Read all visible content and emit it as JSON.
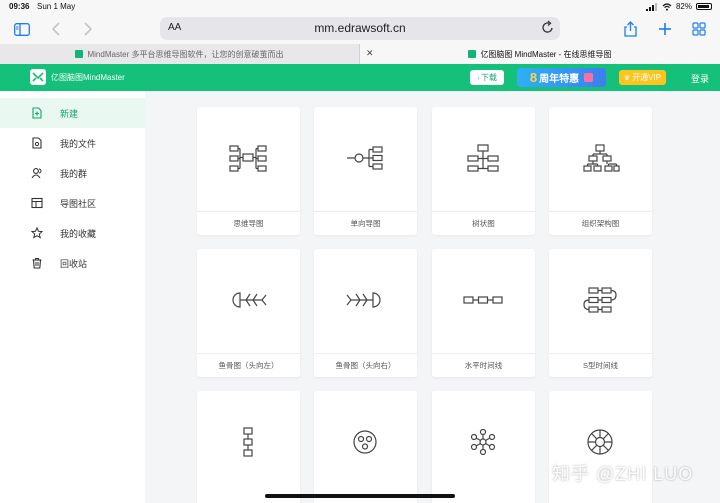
{
  "status": {
    "time": "09:36",
    "date": "Sun 1 May",
    "battery": "82%"
  },
  "browser": {
    "aa": "AA",
    "url": "mm.edrawsoft.cn",
    "tabs": [
      {
        "label": "MindMaster 多平台思维导图软件，让您的创意破茧而出",
        "active": false
      },
      {
        "label": "亿图脑图 MindMaster - 在线思维导图",
        "active": true
      }
    ]
  },
  "appbar": {
    "brand": "亿图脑图MindMaster",
    "download": "下载",
    "promo_number": "8",
    "promo_text": "周年特惠",
    "vip": "开通VIP",
    "login": "登录",
    "colors": {
      "header": "#14c07a",
      "vip": "#ffc41e"
    }
  },
  "sidebar": {
    "items": [
      {
        "label": "新建",
        "icon": "new-file-icon",
        "active": true
      },
      {
        "label": "我的文件",
        "icon": "my-files-icon",
        "active": false
      },
      {
        "label": "我的群",
        "icon": "group-icon",
        "active": false
      },
      {
        "label": "导图社区",
        "icon": "community-icon",
        "active": false
      },
      {
        "label": "我的收藏",
        "icon": "star-icon",
        "active": false
      },
      {
        "label": "回收站",
        "icon": "trash-icon",
        "active": false
      }
    ]
  },
  "templates": [
    {
      "label": "思维导图",
      "icon": "mind-map-icon"
    },
    {
      "label": "单向导图",
      "icon": "one-way-map-icon"
    },
    {
      "label": "树状图",
      "icon": "tree-chart-icon"
    },
    {
      "label": "组织架构图",
      "icon": "org-chart-icon"
    },
    {
      "label": "鱼骨图（头向左）",
      "icon": "fishbone-left-icon"
    },
    {
      "label": "鱼骨图（头向右）",
      "icon": "fishbone-right-icon"
    },
    {
      "label": "水平时间线",
      "icon": "horizontal-timeline-icon"
    },
    {
      "label": "S型时间线",
      "icon": "s-timeline-icon"
    },
    {
      "label": "",
      "icon": "vertical-timeline-icon"
    },
    {
      "label": "",
      "icon": "circle-map-icon"
    },
    {
      "label": "",
      "icon": "bubble-map-icon"
    },
    {
      "label": "",
      "icon": "sector-map-icon"
    }
  ],
  "watermark": "知乎 @ZHI LUO"
}
